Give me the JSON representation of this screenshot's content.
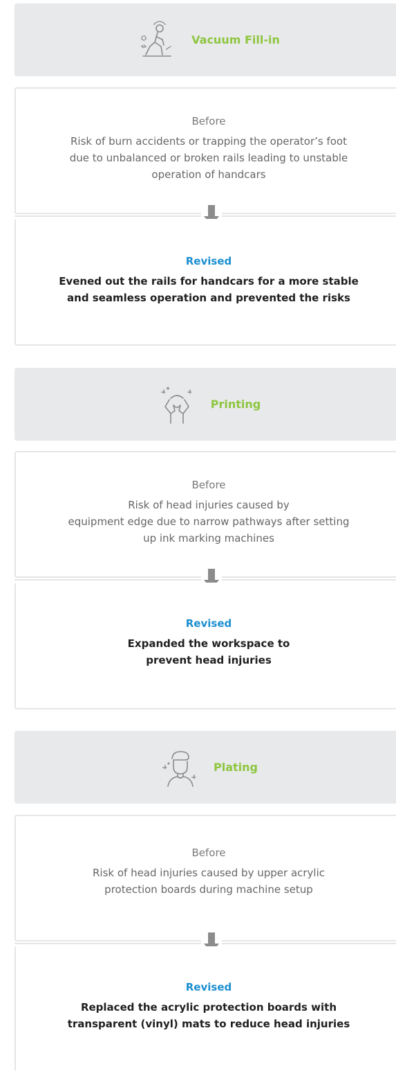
{
  "sections": [
    {
      "title": "Vacuum Fill-in",
      "icon": "kneeling-worker-icon",
      "before_label": "Before",
      "before_text": [
        "Risk of burn accidents or trapping the operator’s foot",
        "due to unbalanced or broken rails leading to unstable",
        "operation of handcars"
      ],
      "revised_label": "Revised",
      "revised_text": [
        "Evened out the rails for handcars for a more stable",
        "and seamless operation and prevented the risks"
      ]
    },
    {
      "title": "Printing",
      "icon": "head-injury-icon",
      "before_label": "Before",
      "before_text": [
        "Risk of head injuries caused by",
        "equipment edge due to narrow pathways after setting",
        "up ink marking machines"
      ],
      "revised_label": "Revised",
      "revised_text": [
        "Expanded the workspace to",
        "prevent head injuries"
      ]
    },
    {
      "title": "Plating",
      "icon": "worker-head-icon",
      "before_label": "Before",
      "before_text": [
        "Risk of head injuries caused by upper acrylic",
        "protection boards during machine setup"
      ],
      "revised_label": "Revised",
      "revised_text": [
        "Replaced the acrylic protection boards with",
        "transparent (vinyl) mats to reduce head injuries"
      ]
    }
  ],
  "colors": {
    "accent_green": "#8dc63f",
    "accent_blue": "#1b8fd1",
    "header_bg": "#e8e9ea",
    "arrow_gray": "#8c8c8c"
  }
}
